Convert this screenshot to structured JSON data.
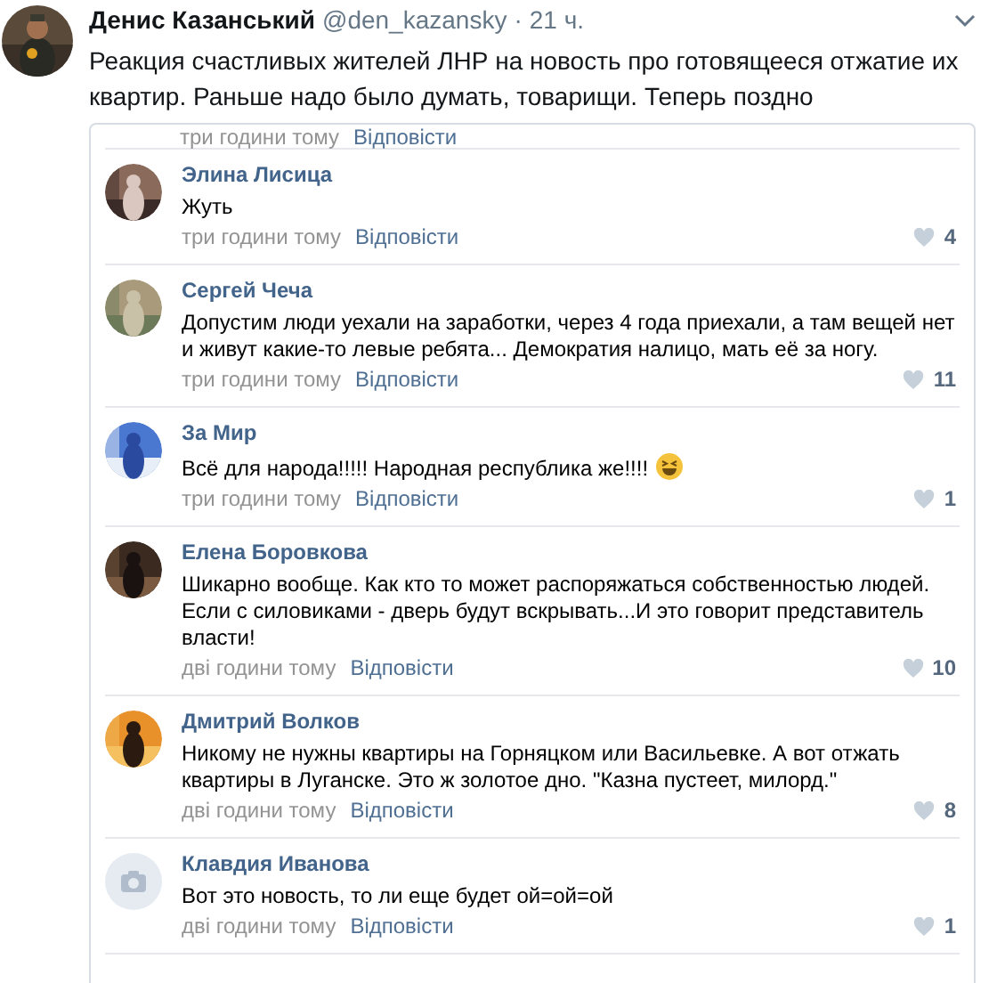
{
  "tweet": {
    "author": "Денис Казанський",
    "handle": "@den_kazansky",
    "dot": "·",
    "time": "21 ч.",
    "text": "Реакция счастливых жителей ЛНР на новость про готовящееся отжатие их квартир. Раньше надо было думать, товарищи. Теперь поздно"
  },
  "embed": {
    "cut_row": {
      "time": "три години тому",
      "reply": "Відповісти"
    },
    "comments": [
      {
        "has_photo": true,
        "name": "Элина Лисица",
        "text": "Жуть",
        "emoji": false,
        "time": "три години тому",
        "reply": "Відповісти",
        "likes": "4"
      },
      {
        "has_photo": true,
        "name": "Сергей Чеча",
        "text": "Допустим люди уехали на заработки, через 4 года приехали, а там вещей нет и живут какие-то левые ребята... Демократия налицо, мать её за ногу.",
        "emoji": false,
        "time": "три години тому",
        "reply": "Відповісти",
        "likes": "11"
      },
      {
        "has_photo": true,
        "name": "За Мир",
        "text": "Всё для народа!!!!! Народная республика же!!!!",
        "emoji": true,
        "time": "три години тому",
        "reply": "Відповісти",
        "likes": "1"
      },
      {
        "has_photo": true,
        "name": "Елена Боровкова",
        "text": "Шикарно вообще. Как кто то может распоряжаться собственностью людей. Если с силовиками - дверь будут вскрывать...И это говорит представитель власти!",
        "emoji": false,
        "time": "дві години тому",
        "reply": "Відповісти",
        "likes": "10"
      },
      {
        "has_photo": true,
        "name": "Дмитрий Волков",
        "text": "Никому не нужны квартиры на Горняцком или Васильевке. А вот отжать квартиры в Луганске. Это ж золотое дно. \"Казна пустеет, милорд.\"",
        "emoji": false,
        "time": "дві години тому",
        "reply": "Відповісти",
        "likes": "8"
      },
      {
        "has_photo": false,
        "name": "Клавдия Иванова",
        "text": "Вот это новость, то ли еще будет ой=ой=ой",
        "emoji": false,
        "time": "дві години тому",
        "reply": "Відповісти",
        "likes": "1"
      }
    ]
  }
}
